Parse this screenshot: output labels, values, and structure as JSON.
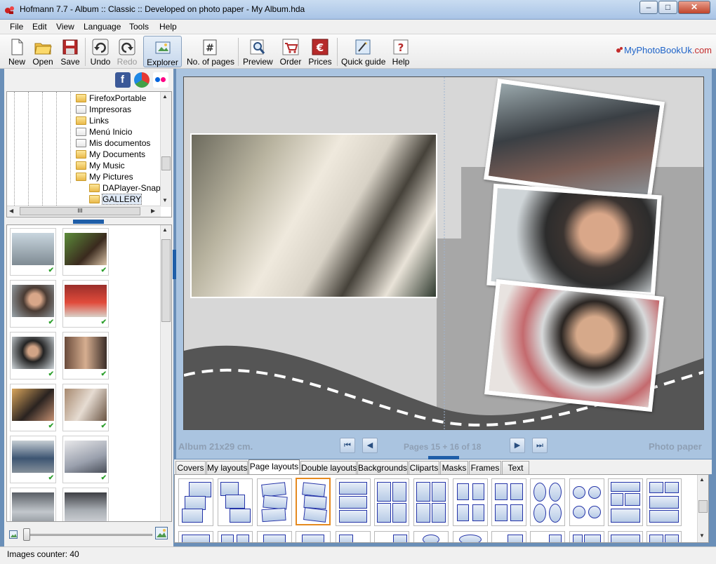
{
  "window": {
    "title": "Hofmann 7.7  -  Album :: Classic :: Developed on photo paper  -  My Album.hda",
    "controls": {
      "minimize": "–",
      "maximize": "□",
      "close": "✕"
    }
  },
  "menu": [
    "File",
    "Edit",
    "View",
    "Language",
    "Tools",
    "Help"
  ],
  "toolbar": {
    "new": "New",
    "open": "Open",
    "save": "Save",
    "undo": "Undo",
    "redo": "Redo",
    "explorer": "Explorer",
    "pages": "No. of pages",
    "preview": "Preview",
    "order": "Order",
    "prices": "Prices",
    "guide": "Quick guide",
    "help": "Help",
    "brand_prefix": "MyPhotoBookUk",
    "brand_suffix": ".com"
  },
  "social": [
    "facebook-icon",
    "picasa-icon",
    "flickr-icon"
  ],
  "tree": {
    "items": [
      {
        "label": "FirefoxPortable",
        "link": false
      },
      {
        "label": "Impresoras",
        "link": true
      },
      {
        "label": "Links",
        "link": false
      },
      {
        "label": "Menú Inicio",
        "link": true
      },
      {
        "label": "Mis documentos",
        "link": true
      },
      {
        "label": "My Documents",
        "link": false
      },
      {
        "label": "My Music",
        "link": false
      },
      {
        "label": "My Pictures",
        "link": false
      },
      {
        "label": "DAPlayer-Snapsh",
        "link": false
      },
      {
        "label": "GALLERY",
        "link": false
      }
    ],
    "scroll_grip": "III"
  },
  "thumbnails_count_visible": 12,
  "status": {
    "images_counter": "Images counter: 40"
  },
  "album": {
    "size_label": "Album 21x29 cm.",
    "pages_label": "Pages 15 + 16 of 18",
    "paper_label": "Photo paper"
  },
  "tabs": [
    "Covers",
    "My layouts",
    "Page layouts",
    "Double layouts",
    "Backgrounds",
    "Cliparts",
    "Masks",
    "Frames",
    "Text"
  ],
  "active_tab": "Page layouts",
  "colors": {
    "accent": "#1f5ea8",
    "selection": "#e58a1f",
    "canvas": "#d7d7d7"
  }
}
